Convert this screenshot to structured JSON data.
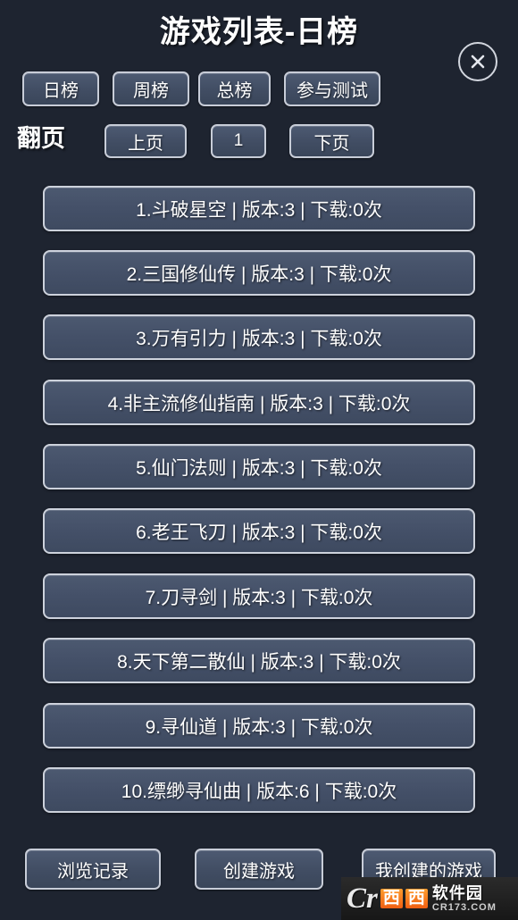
{
  "header": {
    "title": "游戏列表-日榜",
    "close_icon": "close-circle-icon",
    "close_label": "×"
  },
  "tabs": [
    {
      "label": "日榜",
      "active": true
    },
    {
      "label": "周榜",
      "active": false
    },
    {
      "label": "总榜",
      "active": false
    },
    {
      "label": "参与测试",
      "active": false
    }
  ],
  "pager": {
    "label": "翻页",
    "prev_label": "上页",
    "page_number": "1",
    "next_label": "下页"
  },
  "list": {
    "items": [
      {
        "rank": "1",
        "name": "斗破星空",
        "version_label": "版本",
        "version": "3",
        "downloads_label": "下载",
        "downloads": "0次",
        "text": "1.斗破星空 | 版本:3 | 下载:0次"
      },
      {
        "rank": "2",
        "name": "三国修仙传",
        "version_label": "版本",
        "version": "3",
        "downloads_label": "下载",
        "downloads": "0次",
        "text": "2.三国修仙传 | 版本:3 | 下载:0次"
      },
      {
        "rank": "3",
        "name": "万有引力",
        "version_label": "版本",
        "version": "3",
        "downloads_label": "下载",
        "downloads": "0次",
        "text": "3.万有引力 | 版本:3 | 下载:0次"
      },
      {
        "rank": "4",
        "name": "非主流修仙指南",
        "version_label": "版本",
        "version": "3",
        "downloads_label": "下载",
        "downloads": "0次",
        "text": "4.非主流修仙指南 | 版本:3 | 下载:0次"
      },
      {
        "rank": "5",
        "name": "仙门法则",
        "version_label": "版本",
        "version": "3",
        "downloads_label": "下载",
        "downloads": "0次",
        "text": "5.仙门法则 | 版本:3 | 下载:0次"
      },
      {
        "rank": "6",
        "name": "老王飞刀",
        "version_label": "版本",
        "version": "3",
        "downloads_label": "下载",
        "downloads": "0次",
        "text": "6.老王飞刀 | 版本:3 | 下载:0次"
      },
      {
        "rank": "7",
        "name": "刀寻剑",
        "version_label": "版本",
        "version": "3",
        "downloads_label": "下载",
        "downloads": "0次",
        "text": "7.刀寻剑 | 版本:3 | 下载:0次"
      },
      {
        "rank": "8",
        "name": "天下第二散仙",
        "version_label": "版本",
        "version": "3",
        "downloads_label": "下载",
        "downloads": "0次",
        "text": "8.天下第二散仙 | 版本:3 | 下载:0次"
      },
      {
        "rank": "9",
        "name": "寻仙道",
        "version_label": "版本",
        "version": "3",
        "downloads_label": "下载",
        "downloads": "0次",
        "text": "9.寻仙道 | 版本:3 | 下载:0次"
      },
      {
        "rank": "10",
        "name": "缥缈寻仙曲",
        "version_label": "版本",
        "version": "6",
        "downloads_label": "下载",
        "downloads": "0次",
        "text": "10.缥缈寻仙曲 | 版本:6 | 下载:0次"
      }
    ]
  },
  "bottom_actions": [
    {
      "label": "浏览记录"
    },
    {
      "label": "创建游戏"
    },
    {
      "label": "我创建的游戏"
    }
  ],
  "watermark": {
    "logo": "Cr",
    "brand_a": "西",
    "brand_b": "西",
    "site_name": "软件园",
    "url": "CR173.COM"
  },
  "colors": {
    "background": "#1e2430",
    "button_fill": "#444f66",
    "button_border": "#cdd2dc",
    "text": "#ffffff",
    "watermark_accent": "#ef5f12"
  }
}
